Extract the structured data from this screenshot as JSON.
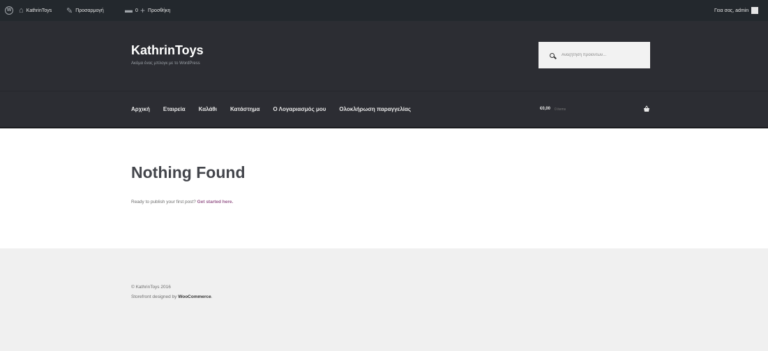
{
  "adminbar": {
    "site_name": "KathrinToys",
    "customize": "Προσαρμογή",
    "comments_count": "0",
    "new": "Προσθήκη",
    "howdy": "Γεια σας, admin"
  },
  "header": {
    "title": "KathrinToys",
    "description": "Ακόμα ένας μπλογκ με το WordPress",
    "search_placeholder": "Αναζήτηση προϊόντων..."
  },
  "nav": {
    "items": [
      "Αρχική",
      "Εταιρεία",
      "Καλάθι",
      "Κατάστημα",
      "Ο Λογαριασμός μου",
      "Ολοκλήρωση παραγγελίας"
    ]
  },
  "cart": {
    "amount": "€0,00",
    "count": "0 items"
  },
  "main": {
    "title": "Nothing Found",
    "text": "Ready to publish your first post?",
    "link": "Get started here."
  },
  "footer": {
    "copyright": "© KathrinToys 2016",
    "designed_prefix": "Storefront designed by",
    "brand": "WooCommerce",
    "suffix": "."
  }
}
